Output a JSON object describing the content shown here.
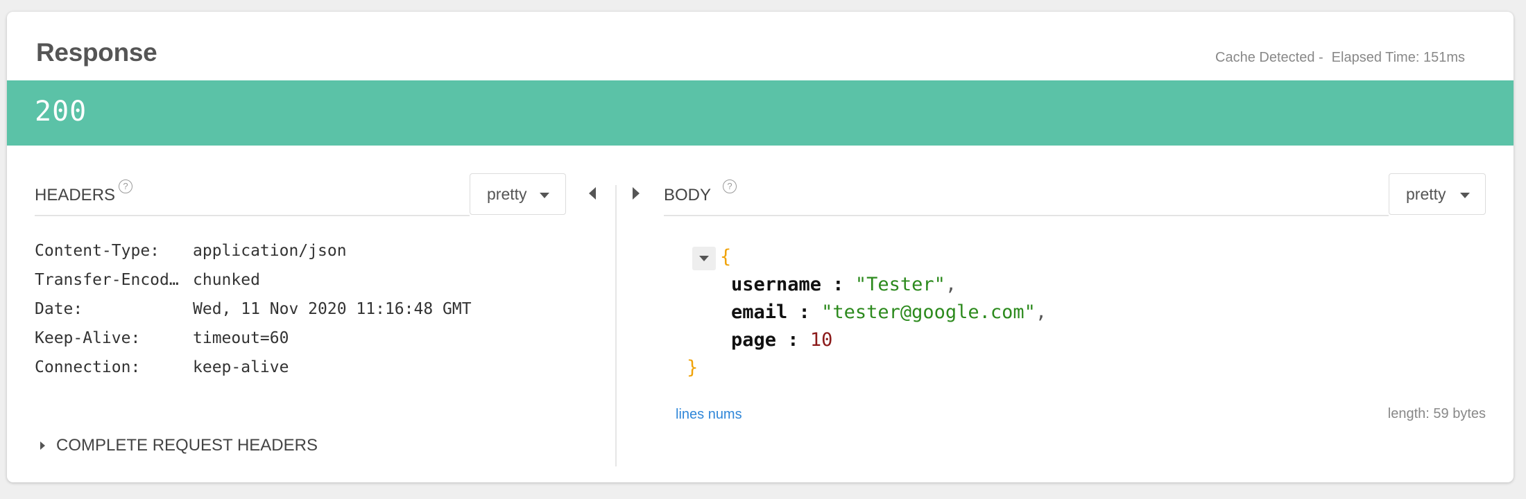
{
  "response": {
    "title": "Response",
    "cache_text": "Cache Detected -",
    "elapsed_text": "Elapsed Time: 151ms",
    "status_code": "200",
    "status_color": "#5bc2a7"
  },
  "headers_panel": {
    "label": "HEADERS",
    "help_glyph": "?",
    "format_select": "pretty",
    "rows": [
      {
        "key": "Content-Type:",
        "value": "application/json"
      },
      {
        "key": "Transfer-Encod…",
        "value": "chunked"
      },
      {
        "key": "Date:",
        "value": "Wed, 11 Nov 2020 11:16:48 GMT"
      },
      {
        "key": "Keep-Alive:",
        "value": "timeout=60"
      },
      {
        "key": "Connection:",
        "value": "keep-alive"
      }
    ],
    "complete_request_headers": "COMPLETE REQUEST HEADERS"
  },
  "body_panel": {
    "label": "BODY",
    "help_glyph": "?",
    "format_select": "pretty",
    "json": {
      "open_brace": "{",
      "close_brace": "}",
      "lines": [
        {
          "key": "username",
          "colon": " : ",
          "value": "\"Tester\"",
          "comma": ","
        },
        {
          "key": "email",
          "colon": " : ",
          "value": "\"tester@google.com\"",
          "comma": ","
        },
        {
          "key": "page",
          "colon": " : ",
          "value": "10",
          "comma": ""
        }
      ]
    },
    "lines_nums": "lines nums",
    "length": "length: 59 bytes"
  },
  "icons": {
    "collapse_left": "triangle-left-icon",
    "expand_right": "triangle-right-icon",
    "help": "question-circle-icon",
    "caret": "caret-down-icon",
    "json_toggle": "triangle-down-icon",
    "complete_headers_toggle": "triangle-right-icon"
  }
}
